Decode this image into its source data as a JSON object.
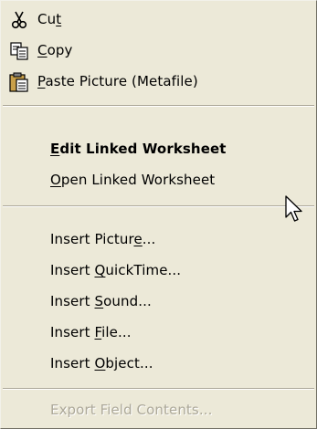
{
  "menu": {
    "clipboard": [
      {
        "label": "Cut",
        "mnemonic_index": 2,
        "icon": "scissors-icon"
      },
      {
        "label": "Copy",
        "mnemonic_index": 0,
        "icon": "copy-icon"
      },
      {
        "label": "Paste Picture (Metafile)",
        "mnemonic_index": 0,
        "icon": "paste-icon"
      }
    ],
    "worksheet": [
      {
        "label": "Edit Linked Worksheet",
        "mnemonic_index": 0,
        "bold": true
      },
      {
        "label": "Open Linked Worksheet",
        "mnemonic_index": 0
      }
    ],
    "insert": [
      {
        "label": "Insert Picture...",
        "mnemonic_index": 13
      },
      {
        "label": "Insert QuickTime...",
        "mnemonic_index": 7
      },
      {
        "label": "Insert Sound...",
        "mnemonic_index": 7
      },
      {
        "label": "Insert File...",
        "mnemonic_index": 7
      },
      {
        "label": "Insert Object...",
        "mnemonic_index": 7
      }
    ],
    "export": [
      {
        "label": "Export Field Contents...",
        "disabled": true
      }
    ]
  },
  "cursor": {
    "icon": "arrow-cursor-icon"
  }
}
